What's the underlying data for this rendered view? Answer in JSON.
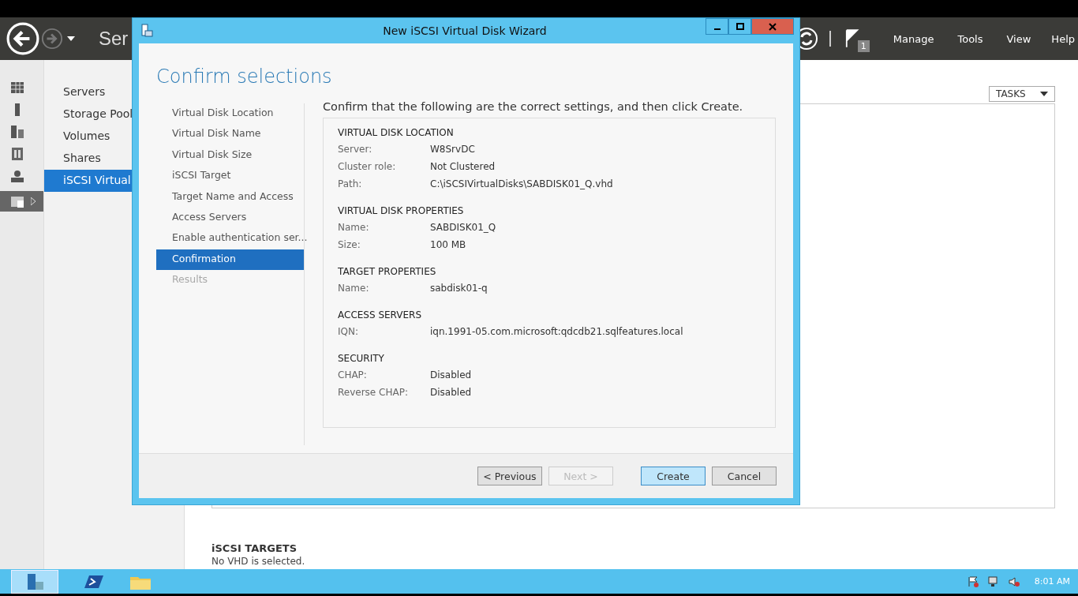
{
  "app": {
    "title": "Ser",
    "menus": [
      "Manage",
      "Tools",
      "View",
      "Help"
    ],
    "notification_count": "1"
  },
  "nav": {
    "items": [
      {
        "label": "Servers",
        "selected": false
      },
      {
        "label": "Storage Pool",
        "selected": false
      },
      {
        "label": "Volumes",
        "selected": false
      },
      {
        "label": "Shares",
        "selected": false
      },
      {
        "label": "iSCSI Virtual",
        "selected": true
      }
    ]
  },
  "tasks_button": "TASKS",
  "targets": {
    "heading": "iSCSI TARGETS",
    "message": "No VHD is selected."
  },
  "taskbar": {
    "time": "8:01 AM"
  },
  "dialog": {
    "title": "New iSCSI Virtual Disk Wizard",
    "heading": "Confirm selections",
    "steps": [
      {
        "label": "Virtual Disk Location",
        "selected": false,
        "disabled": false
      },
      {
        "label": "Virtual Disk Name",
        "selected": false,
        "disabled": false
      },
      {
        "label": "Virtual Disk Size",
        "selected": false,
        "disabled": false
      },
      {
        "label": "iSCSI Target",
        "selected": false,
        "disabled": false
      },
      {
        "label": "Target Name and Access",
        "selected": false,
        "disabled": false
      },
      {
        "label": "Access Servers",
        "selected": false,
        "disabled": false
      },
      {
        "label": "Enable authentication ser...",
        "selected": false,
        "disabled": false
      },
      {
        "label": "Confirmation",
        "selected": true,
        "disabled": false
      },
      {
        "label": "Results",
        "selected": false,
        "disabled": true
      }
    ],
    "intro": "Confirm that the following are the correct settings, and then click Create.",
    "sections": [
      {
        "title": "VIRTUAL DISK LOCATION",
        "rows": [
          {
            "label": "Server:",
            "value": "W8SrvDC"
          },
          {
            "label": "Cluster role:",
            "value": "Not Clustered"
          },
          {
            "label": "Path:",
            "value": "C:\\iSCSIVirtualDisks\\SABDISK01_Q.vhd"
          }
        ]
      },
      {
        "title": "VIRTUAL DISK PROPERTIES",
        "rows": [
          {
            "label": "Name:",
            "value": "SABDISK01_Q"
          },
          {
            "label": "Size:",
            "value": "100 MB"
          }
        ]
      },
      {
        "title": "TARGET PROPERTIES",
        "rows": [
          {
            "label": "Name:",
            "value": "sabdisk01-q"
          }
        ]
      },
      {
        "title": "ACCESS SERVERS",
        "rows": [
          {
            "label": "IQN:",
            "value": "iqn.1991-05.com.microsoft:qdcdb21.sqlfeatures.local"
          }
        ]
      },
      {
        "title": "SECURITY",
        "rows": [
          {
            "label": "CHAP:",
            "value": "Disabled"
          },
          {
            "label": "Reverse CHAP:",
            "value": "Disabled"
          }
        ]
      }
    ],
    "buttons": [
      {
        "label": "< Previous",
        "kind": "normal",
        "disabled": false
      },
      {
        "label": "Next >",
        "kind": "normal",
        "disabled": true
      },
      {
        "label": "Create",
        "kind": "default",
        "disabled": false
      },
      {
        "label": "Cancel",
        "kind": "normal",
        "disabled": false
      }
    ]
  }
}
